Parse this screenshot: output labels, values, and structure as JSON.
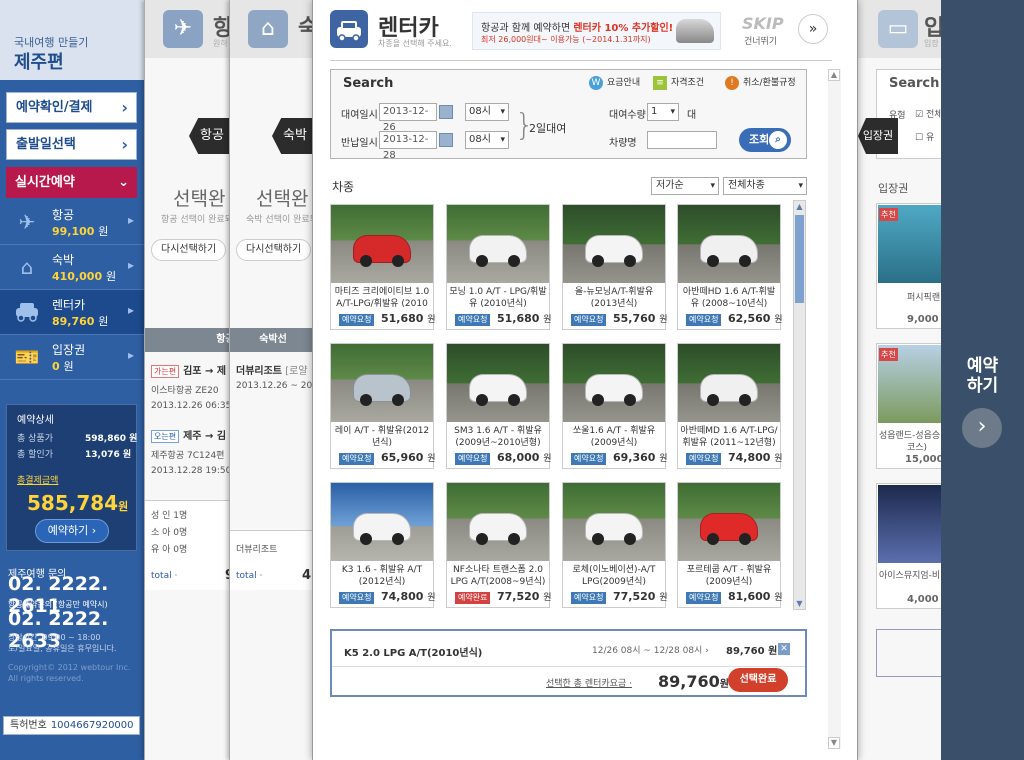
{
  "sidebar": {
    "subtitle": "국내여행 만들기",
    "title": "제주편",
    "btn_confirm": "예약확인/결제",
    "btn_date": "출발일선택",
    "btn_live": "실시간예약",
    "items": [
      {
        "label": "항공",
        "price": "99,100",
        "unit": "원",
        "icon": "airplane-icon"
      },
      {
        "label": "숙박",
        "price": "410,000",
        "unit": "원",
        "icon": "house-icon"
      },
      {
        "label": "렌터카",
        "price": "89,760",
        "unit": "원",
        "icon": "car-icon"
      },
      {
        "label": "입장권",
        "price": "0",
        "unit": "원",
        "icon": "ticket-icon"
      }
    ],
    "summary": {
      "heading": "예약상세",
      "goods_label": "총 상품가",
      "goods_value": "598,860 원",
      "discount_label": "총 할인가",
      "discount_value": "13,076 원",
      "total_label": "총결제금액",
      "total_value": "585,784",
      "total_unit": "원",
      "book_btn": "예약하기 ›"
    },
    "cs1_label": "제주여행 문의",
    "cs1_number": "02. 2222. 2611",
    "cs2_label": "항공예약문의 (항공만 예약시)",
    "cs2_number": "02. 2222. 2633",
    "hours_1": "상담시간. 09:00 ~ 18:00",
    "hours_2": "토/일요일, 공휴일은 휴무입니다.",
    "copy_1": "Copyright© 2012 webtour Inc.",
    "copy_2": "All rights reserved.",
    "patent_label": "특허번호",
    "patent_value": "1004667920000"
  },
  "flight_panel": {
    "title": "항",
    "sub": "원하",
    "hex": "항공",
    "big": "선택완",
    "small": "항공 선택이 완료되",
    "pill": "다시선택하기",
    "table_head": "항공선",
    "go_tag": "가는편",
    "go_route": "김포 → 제",
    "go_air": "이스타항공 ZE20",
    "go_time": "2013.12.26 06:35 ~",
    "back_tag": "오는편",
    "back_route": "제주 → 김",
    "back_air": "제주항공 7C124편",
    "back_time": "2013.12.28 19:50 ~",
    "pax_1": "성 인 1명",
    "pax_2": "소 아 0명",
    "pax_3": "유 아 0명",
    "total": "total ·",
    "total_digit": "9"
  },
  "hotel_panel": {
    "title": "숙",
    "hex": "숙박",
    "big": "선택완",
    "small": "숙박 선택이 완료되",
    "pill": "다시선택하기",
    "table_head": "숙박선",
    "hotel": "더뷰리조트",
    "hotel_type": "[로얄",
    "dates": "2013.12.26 ~ 201",
    "hotel_2": "더뷰리조트",
    "total": "total ·",
    "total_digit": "4"
  },
  "ticket_panel": {
    "title": "입",
    "sub": "입장",
    "search": "Search",
    "type_label": "유형",
    "chk_all": "전체",
    "chk_2": "유",
    "hex": "입장권",
    "list_title": "입장권",
    "badge": "추천",
    "t1_name": "퍼시픽랜",
    "t1_price": "9,000",
    "t2_name": "성읍랜드-성읍승",
    "t2_name2": "코스)",
    "t2_price": "15,000",
    "t3_name": "아이스뮤지엄-비",
    "t3_price": "4,000",
    "book_1": "예약",
    "book_2": "하기"
  },
  "dialog": {
    "title": "렌터카",
    "subtitle": "차종을 선택해 주세요.",
    "banner_1a": "항공과 함께 예약하면",
    "banner_1b": "렌터카 10% 추가할인!",
    "banner_2": "최저 26,000원대~ 이용가능 (~2014.1.31까지)",
    "skip": "SKIP",
    "skip_sub": "건너뛰기",
    "search": {
      "heading": "Search",
      "link_fee": "요금안내",
      "link_qual": "자격조건",
      "link_cancel": "취소/환불규정",
      "pickup_label": "대여일시",
      "pickup_date": "2013-12-26",
      "pickup_hour": "08시",
      "return_label": "반납일시",
      "return_date": "2013-12-28",
      "return_hour": "08시",
      "duration": "2일대여",
      "qty_label": "대여수량",
      "qty_value": "1",
      "qty_unit": "대",
      "car_label": "차량명",
      "car_value": "",
      "search_btn": "조회"
    },
    "list_title": "차종",
    "sort_1": "저가순",
    "sort_2": "전체차종",
    "cars": [
      {
        "name": "마티즈 크리에이티브 1.0 A/T-LPG/휘발유 (2010",
        "badge": "예약요청",
        "price": "51,680",
        "unit": "원",
        "color": "#d62a2a",
        "scene": ""
      },
      {
        "name": "모닝 1.0 A/T - LPG/휘발유 (2010년식)",
        "badge": "예약요청",
        "price": "51,680",
        "unit": "원",
        "color": "#f2f2f2",
        "scene": ""
      },
      {
        "name": "올-뉴모닝A/T-휘발유 (2013년식)",
        "badge": "예약요청",
        "price": "55,760",
        "unit": "원",
        "color": "#f4f4f4",
        "scene": "dark"
      },
      {
        "name": "아반떼HD 1.6 A/T-휘발유 (2008~10년식)",
        "badge": "예약요청",
        "price": "62,560",
        "unit": "원",
        "color": "#f0f0f0",
        "scene": "dark"
      },
      {
        "name": "레이 A/T - 휘발유(2012년식)",
        "badge": "예약요청",
        "price": "65,960",
        "unit": "원",
        "color": "#b9c3cc",
        "scene": ""
      },
      {
        "name": "SM3 1.6 A/T - 휘발유 (2009년~2010년형)",
        "badge": "예약요청",
        "price": "68,000",
        "unit": "원",
        "color": "#f4f4f4",
        "scene": "dark"
      },
      {
        "name": "쏘울1.6 A/T - 휘발유 (2009년식)",
        "badge": "예약요청",
        "price": "69,360",
        "unit": "원",
        "color": "#f4f4f4",
        "scene": "dark"
      },
      {
        "name": "아반떼MD 1.6 A/T-LPG/휘발유 (2011~12년형)",
        "badge": "예약요청",
        "price": "74,800",
        "unit": "원",
        "color": "#f0f0f0",
        "scene": "dark"
      },
      {
        "name": "K3 1.6 - 휘발유 A/T (2012년식)",
        "badge": "예약요청",
        "price": "74,800",
        "unit": "원",
        "color": "#f4f4f4",
        "scene": "sky"
      },
      {
        "name": "NF소나타 트랜스폼 2.0 LPG A/T(2008~9년식)",
        "badge": "예약완료",
        "price": "77,520",
        "unit": "원",
        "color": "#f4f4f4",
        "scene": ""
      },
      {
        "name": "로체(이노베이션)-A/T LPG(2009년식)",
        "badge": "예약요청",
        "price": "77,520",
        "unit": "원",
        "color": "#f4f4f4",
        "scene": ""
      },
      {
        "name": "포르테쿱 A/T - 휘발유 (2009년식)",
        "badge": "예약요청",
        "price": "81,600",
        "unit": "원",
        "color": "#e02a2a",
        "scene": ""
      }
    ],
    "selected": {
      "name": "K5 2.0 LPG A/T(2010년식)",
      "dates": "12/26 08시 ~ 12/28 08시 ›",
      "price": "89,760 원",
      "label": "선택한 총 렌터카요금 ·",
      "total": "89,760",
      "unit": "원",
      "btn": "선택완료"
    }
  }
}
